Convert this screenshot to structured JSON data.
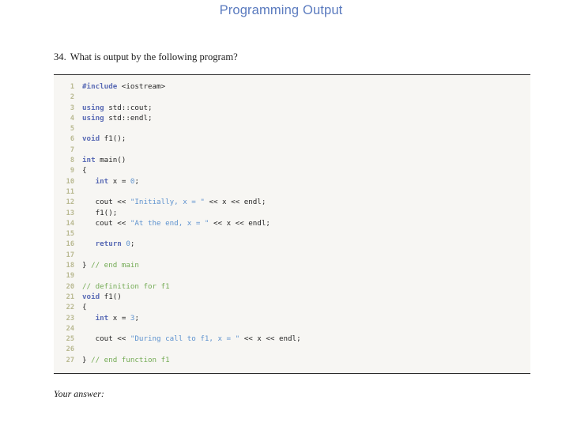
{
  "slide": {
    "title": "Programming Output",
    "title_color": "#5b7bbf",
    "background": "#ffffff"
  },
  "question": {
    "number": "34.",
    "text": "What is output by the following program?"
  },
  "code_block": {
    "background": "#f7f6f3",
    "rule_color": "#2b2b2b",
    "line_number_color": "#b9b991",
    "colors": {
      "keyword": "#5a6bb5",
      "string": "#5f93cf",
      "number": "#5f93cf",
      "comment": "#74ab55",
      "plain": "#262626"
    },
    "lines": [
      {
        "n": "1",
        "tokens": [
          {
            "t": "kw",
            "v": "#include"
          },
          {
            "t": "pln",
            "v": " <iostream>"
          }
        ]
      },
      {
        "n": "2",
        "tokens": []
      },
      {
        "n": "3",
        "tokens": [
          {
            "t": "kw",
            "v": "using"
          },
          {
            "t": "pln",
            "v": " std::cout;"
          }
        ]
      },
      {
        "n": "4",
        "tokens": [
          {
            "t": "kw",
            "v": "using"
          },
          {
            "t": "pln",
            "v": " std::endl;"
          }
        ]
      },
      {
        "n": "5",
        "tokens": []
      },
      {
        "n": "6",
        "tokens": [
          {
            "t": "kw",
            "v": "void"
          },
          {
            "t": "pln",
            "v": " f1();"
          }
        ]
      },
      {
        "n": "7",
        "tokens": []
      },
      {
        "n": "8",
        "tokens": [
          {
            "t": "kw",
            "v": "int"
          },
          {
            "t": "pln",
            "v": " main()"
          }
        ]
      },
      {
        "n": "9",
        "tokens": [
          {
            "t": "pln",
            "v": "{"
          }
        ]
      },
      {
        "n": "10",
        "tokens": [
          {
            "t": "pln",
            "v": "   "
          },
          {
            "t": "kw",
            "v": "int"
          },
          {
            "t": "pln",
            "v": " x = "
          },
          {
            "t": "num",
            "v": "0"
          },
          {
            "t": "pln",
            "v": ";"
          }
        ]
      },
      {
        "n": "11",
        "tokens": []
      },
      {
        "n": "12",
        "tokens": [
          {
            "t": "pln",
            "v": "   cout << "
          },
          {
            "t": "str",
            "v": "\"Initially, x = \""
          },
          {
            "t": "pln",
            "v": " << x << endl;"
          }
        ]
      },
      {
        "n": "13",
        "tokens": [
          {
            "t": "pln",
            "v": "   f1();"
          }
        ]
      },
      {
        "n": "14",
        "tokens": [
          {
            "t": "pln",
            "v": "   cout << "
          },
          {
            "t": "str",
            "v": "\"At the end, x = \""
          },
          {
            "t": "pln",
            "v": " << x << endl;"
          }
        ]
      },
      {
        "n": "15",
        "tokens": []
      },
      {
        "n": "16",
        "tokens": [
          {
            "t": "pln",
            "v": "   "
          },
          {
            "t": "kw",
            "v": "return"
          },
          {
            "t": "pln",
            "v": " "
          },
          {
            "t": "num",
            "v": "0"
          },
          {
            "t": "pln",
            "v": ";"
          }
        ]
      },
      {
        "n": "17",
        "tokens": []
      },
      {
        "n": "18",
        "tokens": [
          {
            "t": "pln",
            "v": "} "
          },
          {
            "t": "cmt",
            "v": "// end main"
          }
        ]
      },
      {
        "n": "19",
        "tokens": []
      },
      {
        "n": "20",
        "tokens": [
          {
            "t": "cmt",
            "v": "// definition for f1"
          }
        ]
      },
      {
        "n": "21",
        "tokens": [
          {
            "t": "kw",
            "v": "void"
          },
          {
            "t": "pln",
            "v": " f1()"
          }
        ]
      },
      {
        "n": "22",
        "tokens": [
          {
            "t": "pln",
            "v": "{"
          }
        ]
      },
      {
        "n": "23",
        "tokens": [
          {
            "t": "pln",
            "v": "   "
          },
          {
            "t": "kw",
            "v": "int"
          },
          {
            "t": "pln",
            "v": " x = "
          },
          {
            "t": "num",
            "v": "3"
          },
          {
            "t": "pln",
            "v": ";"
          }
        ]
      },
      {
        "n": "24",
        "tokens": []
      },
      {
        "n": "25",
        "tokens": [
          {
            "t": "pln",
            "v": "   cout << "
          },
          {
            "t": "str",
            "v": "\"During call to f1, x = \""
          },
          {
            "t": "pln",
            "v": " << x << endl;"
          }
        ]
      },
      {
        "n": "26",
        "tokens": []
      },
      {
        "n": "27",
        "tokens": [
          {
            "t": "pln",
            "v": "} "
          },
          {
            "t": "cmt",
            "v": "// end function f1"
          }
        ]
      }
    ]
  },
  "answer_prompt": {
    "label": "Your answer:"
  }
}
